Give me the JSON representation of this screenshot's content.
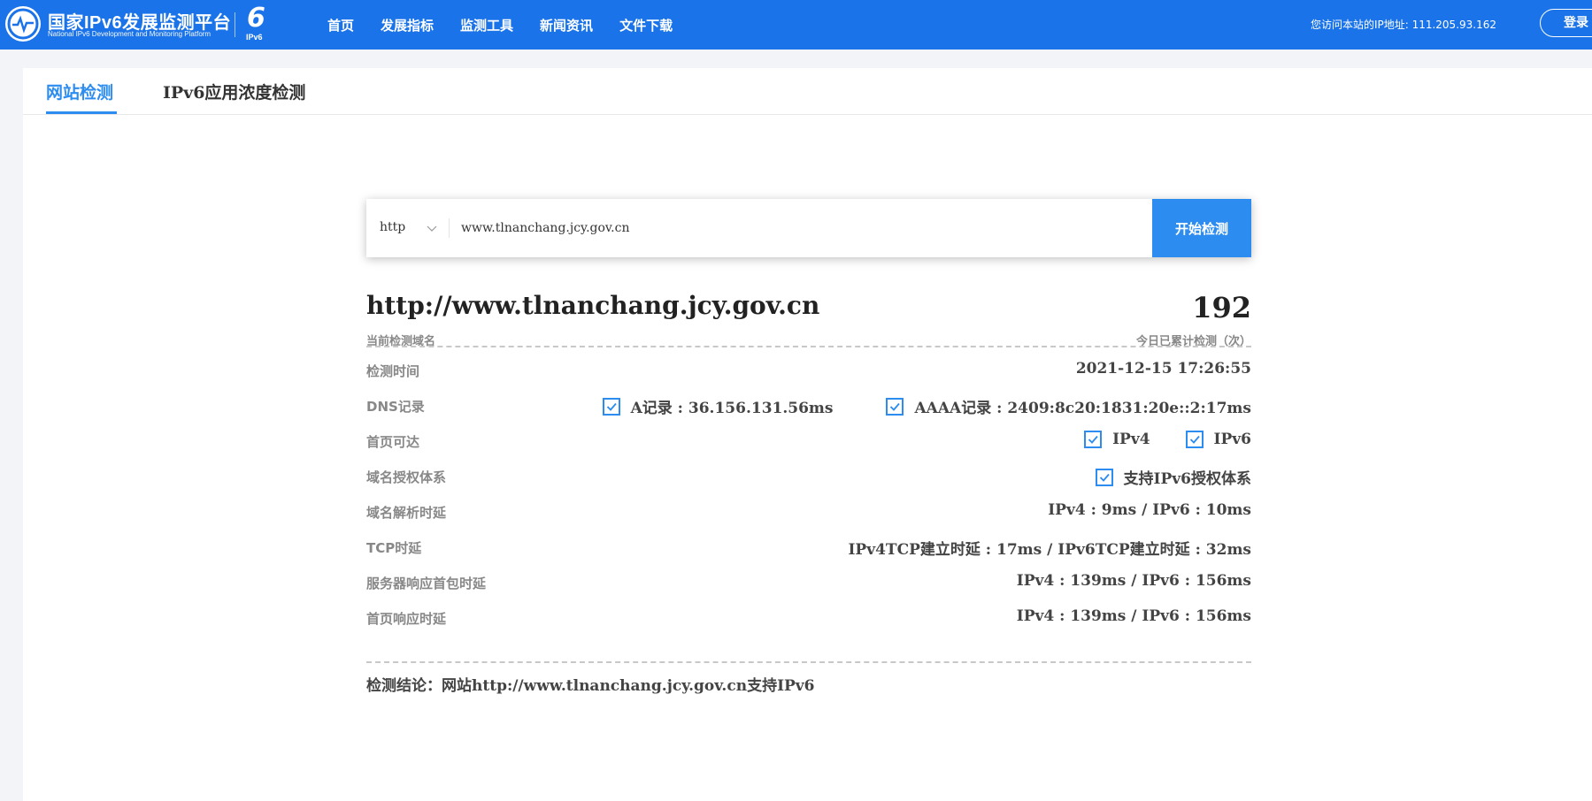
{
  "header": {
    "brand_cn": "国家IPv6发展监测平台",
    "brand_en": "National IPv6 Development and Monitoring Platform",
    "ipv6_badge": "IPv6",
    "nav": [
      "首页",
      "发展指标",
      "监测工具",
      "新闻资讯",
      "文件下载"
    ],
    "visitor_ip": "您访问本站的IP地址: 111.205.93.162",
    "login_label": "登录",
    "colors": {
      "bar": "#1a73e8",
      "accent": "#2d8cf0"
    }
  },
  "tabs": [
    {
      "label": "网站检测",
      "active": true
    },
    {
      "label": "IPv6应用浓度检测",
      "active": false
    }
  ],
  "search": {
    "protocol": "http",
    "url_value": "www.tlnanchang.jcy.gov.cn",
    "button_label": "开始检测"
  },
  "result": {
    "domain": "http://www.tlnanchang.jcy.gov.cn",
    "domain_caption": "当前检测域名",
    "count": "192",
    "count_caption": "今日已累计检测（次）",
    "rows": {
      "time": {
        "label": "检测时间",
        "value": "2021-12-15 17:26:55"
      },
      "dns": {
        "label": "DNS记录",
        "a_record": "A记录 : 36.156.131.56ms",
        "aaaa_record": "AAAA记录 : 2409:8c20:1831:20e::2:17ms"
      },
      "reachable": {
        "label": "首页可达",
        "ipv4": "IPv4",
        "ipv6": "IPv6"
      },
      "auth": {
        "label": "域名授权体系",
        "value": "支持IPv6授权体系"
      },
      "resolve": {
        "label": "域名解析时延",
        "value": "IPv4 : 9ms / IPv6 : 10ms"
      },
      "tcp": {
        "label": "TCP时延",
        "value": "IPv4TCP建立时延 : 17ms / IPv6TCP建立时延 : 32ms"
      },
      "first_packet": {
        "label": "服务器响应首包时延",
        "value": "IPv4 : 139ms / IPv6 : 156ms"
      },
      "page_response": {
        "label": "首页响应时延",
        "value": "IPv4 : 139ms / IPv6 : 156ms"
      }
    },
    "conclusion": "检测结论：网站http://www.tlnanchang.jcy.gov.cn支持IPv6"
  }
}
